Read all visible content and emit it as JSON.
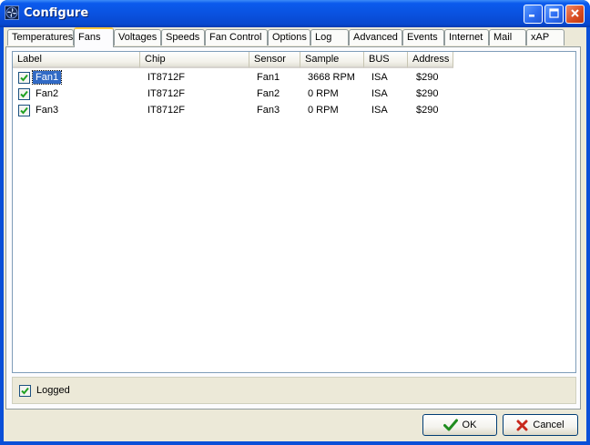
{
  "window": {
    "title": "Configure",
    "icon": "app-fan-icon",
    "controls": [
      "minimize-icon",
      "maximize-icon",
      "close-icon"
    ]
  },
  "tabs": [
    {
      "label": "Temperatures",
      "active": false
    },
    {
      "label": "Fans",
      "active": true
    },
    {
      "label": "Voltages",
      "active": false
    },
    {
      "label": "Speeds",
      "active": false
    },
    {
      "label": "Fan Control",
      "active": false
    },
    {
      "label": "Options",
      "active": false
    },
    {
      "label": "Log",
      "active": false
    },
    {
      "label": "Advanced",
      "active": false
    },
    {
      "label": "Events",
      "active": false
    },
    {
      "label": "Internet",
      "active": false
    },
    {
      "label": "Mail",
      "active": false
    },
    {
      "label": "xAP",
      "active": false
    }
  ],
  "list": {
    "columns": [
      "Label",
      "Chip",
      "Sensor",
      "Sample",
      "BUS",
      "Address"
    ],
    "rows": [
      {
        "checked": true,
        "label": "Fan1",
        "chip": "IT8712F",
        "sensor": "Fan1",
        "sample": "3668 RPM",
        "bus": "ISA",
        "address": "$290",
        "selected": true
      },
      {
        "checked": true,
        "label": "Fan2",
        "chip": "IT8712F",
        "sensor": "Fan2",
        "sample": "0 RPM",
        "bus": "ISA",
        "address": "$290",
        "selected": false
      },
      {
        "checked": true,
        "label": "Fan3",
        "chip": "IT8712F",
        "sensor": "Fan3",
        "sample": "0 RPM",
        "bus": "ISA",
        "address": "$290",
        "selected": false
      }
    ]
  },
  "logged": {
    "label": "Logged",
    "checked": true
  },
  "buttons": {
    "ok": {
      "label": "OK",
      "icon": "checkmark-icon"
    },
    "cancel": {
      "label": "Cancel",
      "icon": "x-icon"
    }
  },
  "colors": {
    "titlebar": "#0a52e0",
    "selection": "#316ac5",
    "tab_highlight": "#ffc73c",
    "ok_check": "#1f8c1f",
    "cancel_x": "#c8281c"
  }
}
